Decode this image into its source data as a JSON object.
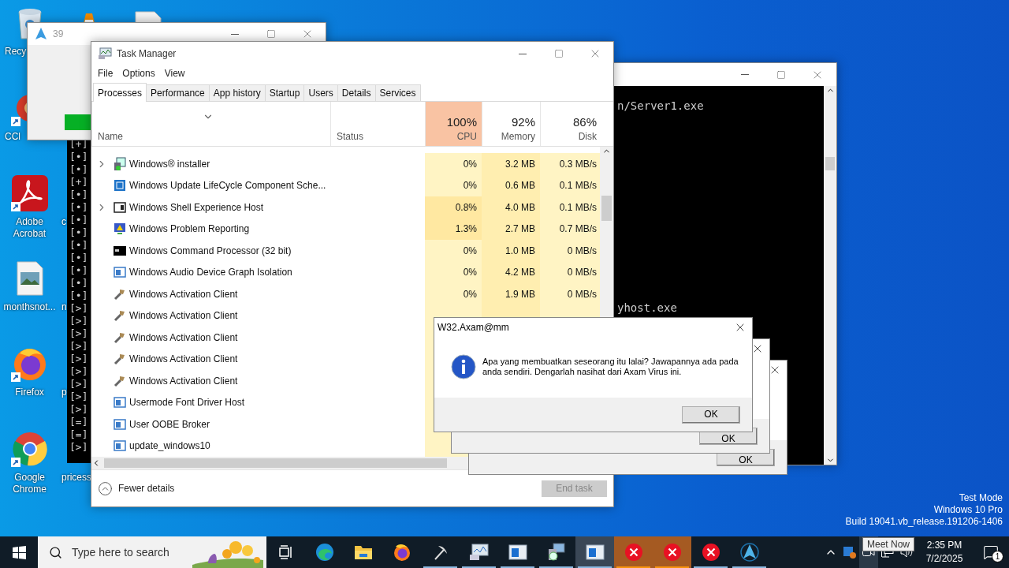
{
  "desktop": {
    "icon_columns": [
      [
        {
          "kind": "recycle",
          "label": "Recy",
          "shortcut": false
        },
        {
          "kind": "ccleaner",
          "label": "CCl",
          "shortcut": true
        },
        {
          "kind": "acrobat",
          "label": "Adobe Acrobat",
          "shortcut": true
        },
        {
          "kind": "image_file",
          "label": "monthsnot...",
          "shortcut": false
        },
        {
          "kind": "firefox",
          "label": "Firefox",
          "shortcut": true
        },
        {
          "kind": "chrome",
          "label": "Google Chrome",
          "shortcut": true
        }
      ],
      [
        {
          "kind": "vlc"
        },
        {
          "kind": "covered"
        },
        {
          "kind": "covered",
          "label": "c"
        },
        {
          "kind": "covered",
          "label": "n"
        },
        {
          "kind": "covered",
          "label": "p"
        },
        {
          "kind": "covered",
          "label": "pricess"
        }
      ],
      [
        {
          "kind": "document"
        }
      ]
    ],
    "os_info": [
      "Test Mode",
      "Windows 10 Pro",
      "Build 19041.vb_release.191206-1406"
    ]
  },
  "console_left": {
    "lines": [
      "[+]",
      "[•]",
      "[•]",
      "[+]",
      "[•]",
      "[•]",
      "[•]",
      "[•]",
      "[•]",
      "[•]",
      "[•]",
      "[•]",
      "[•]",
      "[>]",
      "[>]",
      "[>]",
      "[>]",
      "[>]",
      "[>]",
      "[>]",
      "[>]",
      "[>]",
      "[=]",
      "[=]",
      "[>]"
    ]
  },
  "console_right": {
    "lines": [
      "n/Server1.exe",
      "yhost.exe"
    ]
  },
  "progress_window": {
    "title": "39",
    "level": 1
  },
  "task_manager": {
    "title": "Task Manager",
    "menu": [
      "File",
      "Options",
      "View"
    ],
    "tabs": [
      {
        "label": "Processes",
        "selected": true
      },
      {
        "label": "Performance",
        "selected": false
      },
      {
        "label": "App history",
        "selected": false
      },
      {
        "label": "Startup",
        "selected": false
      },
      {
        "label": "Users",
        "selected": false
      },
      {
        "label": "Details",
        "selected": false
      },
      {
        "label": "Services",
        "selected": false
      }
    ],
    "columns": [
      {
        "label": "Name"
      },
      {
        "label": "Status"
      },
      {
        "reading": "100%",
        "label": "CPU",
        "hot": true
      },
      {
        "reading": "92%",
        "label": "Memory",
        "hot": false
      },
      {
        "reading": "86%",
        "label": "Disk",
        "hot": false
      }
    ],
    "rows": [
      {
        "name": "Windows® installer",
        "kind": "installer",
        "expandable": true,
        "busy": false,
        "cpu": "0%",
        "memory": "3.2 MB",
        "disk": "0.3 MB/s"
      },
      {
        "name": "Windows Update LifeCycle Component Sche...",
        "kind": "update",
        "expandable": false,
        "busy": false,
        "cpu": "0%",
        "memory": "0.6 MB",
        "disk": "0.1 MB/s"
      },
      {
        "name": "Windows Shell Experience Host",
        "kind": "window",
        "expandable": true,
        "busy": true,
        "cpu": "0.8%",
        "memory": "4.0 MB",
        "disk": "0.1 MB/s"
      },
      {
        "name": "Windows Problem Reporting",
        "kind": "problem",
        "expandable": false,
        "busy": true,
        "cpu": "1.3%",
        "memory": "2.7 MB",
        "disk": "0.7 MB/s"
      },
      {
        "name": "Windows Command Processor (32 bit)",
        "kind": "cmd",
        "expandable": false,
        "busy": false,
        "cpu": "0%",
        "memory": "1.0 MB",
        "disk": "0 MB/s"
      },
      {
        "name": "Windows Audio Device Graph Isolation",
        "kind": "app",
        "expandable": false,
        "busy": false,
        "cpu": "0%",
        "memory": "4.2 MB",
        "disk": "0 MB/s"
      },
      {
        "name": "Windows Activation Client",
        "kind": "activation",
        "expandable": false,
        "busy": false,
        "cpu": "0%",
        "memory": "1.9 MB",
        "disk": "0 MB/s"
      },
      {
        "name": "Windows Activation Client",
        "kind": "activation",
        "expandable": false,
        "busy": false
      },
      {
        "name": "Windows Activation Client",
        "kind": "activation",
        "expandable": false,
        "busy": false
      },
      {
        "name": "Windows Activation Client",
        "kind": "activation",
        "expandable": false,
        "busy": false
      },
      {
        "name": "Windows Activation Client",
        "kind": "activation",
        "expandable": false,
        "busy": false
      },
      {
        "name": "Usermode Font Driver Host",
        "kind": "app",
        "expandable": false,
        "busy": false
      },
      {
        "name": "User OOBE Broker",
        "kind": "app",
        "expandable": false,
        "busy": false
      },
      {
        "name": "update_windows10",
        "kind": "app",
        "expandable": false,
        "busy": false
      }
    ],
    "footer": {
      "toggle": "Fewer details",
      "end_task": {
        "label": "End task",
        "disabled": true
      }
    }
  },
  "message_boxes": [
    {
      "kind": "full",
      "title": "W32.Axam@mm",
      "message": "Apa yang membuatkan seseorang itu lalai? Jawapannya ada pada anda sendiri. Dengarlah nasihat dari Axam Virus ini.",
      "button": "OK"
    },
    {
      "kind": "covered",
      "button": "OK"
    },
    {
      "kind": "covered",
      "button": "OK"
    }
  ],
  "taskbar": {
    "search": {
      "placeholder": "Type here to search"
    },
    "apps": [
      {
        "kind": "taskview",
        "running": false,
        "active": false,
        "flashing": false
      },
      {
        "kind": "edge",
        "running": false,
        "active": false,
        "flashing": false
      },
      {
        "kind": "explorer",
        "running": false,
        "active": false,
        "flashing": false
      },
      {
        "kind": "firefox",
        "running": false,
        "active": false,
        "flashing": false
      },
      {
        "kind": "tool",
        "running": true,
        "active": false,
        "flashing": false
      },
      {
        "kind": "taskmgr",
        "running": true,
        "active": false,
        "flashing": false
      },
      {
        "kind": "window",
        "running": true,
        "active": false,
        "flashing": false
      },
      {
        "kind": "setup",
        "running": true,
        "active": false,
        "flashing": false
      },
      {
        "kind": "window",
        "running": true,
        "active": true,
        "flashing": false
      },
      {
        "kind": "error",
        "running": true,
        "active": false,
        "flashing": true
      },
      {
        "kind": "error",
        "running": true,
        "active": false,
        "flashing": true
      },
      {
        "kind": "error",
        "running": true,
        "active": false,
        "flashing": false
      },
      {
        "kind": "sandbox",
        "running": true,
        "active": false,
        "flashing": false
      }
    ],
    "tray": [
      {
        "kind": "overflow",
        "hovered": false
      },
      {
        "kind": "cloud_app",
        "hovered": false
      },
      {
        "kind": "meet_now",
        "hovered": true
      },
      {
        "kind": "network",
        "hovered": false
      },
      {
        "kind": "volume",
        "hovered": false
      }
    ],
    "clock": {
      "time": "2:35 PM",
      "date": "7/2/2025"
    },
    "notifications": {
      "count": "1"
    },
    "tooltip": "Meet Now"
  }
}
